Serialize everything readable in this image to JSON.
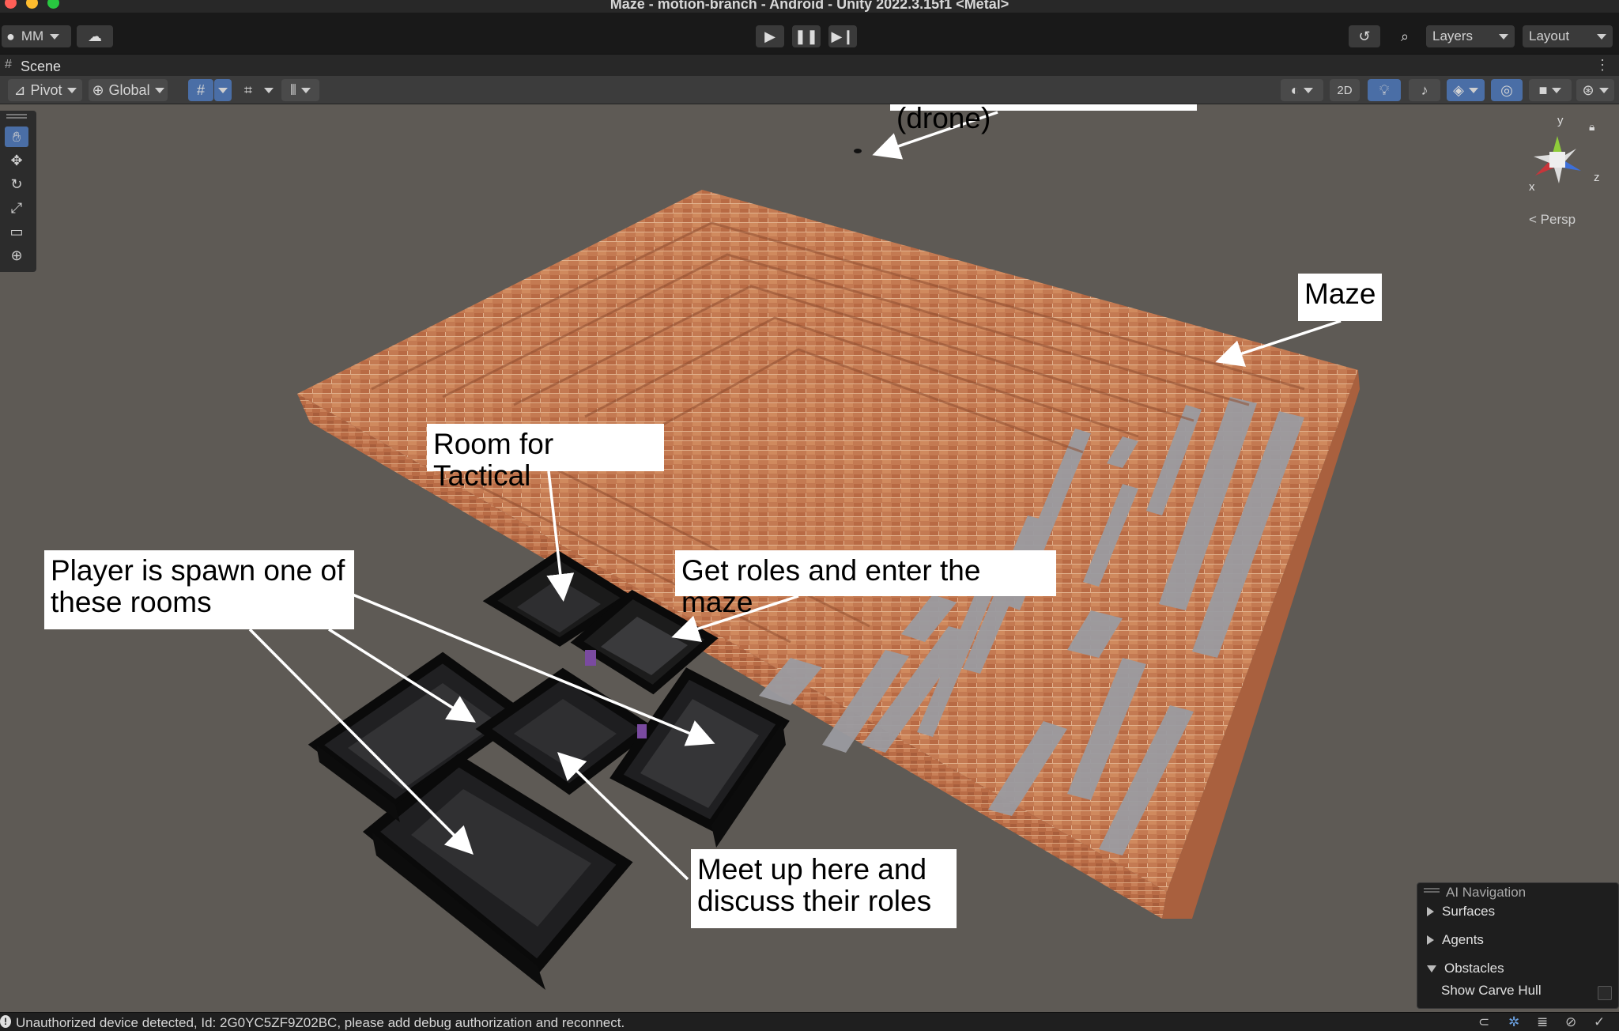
{
  "window": {
    "title": "Maze - motion-branch - Android - Unity 2022.3.15f1 <Metal>"
  },
  "toolbar": {
    "account_label": "MM",
    "layers_label": "Layers",
    "layout_label": "Layout"
  },
  "scene_tab": {
    "label": "Scene"
  },
  "scene_toolbar": {
    "pivot_label": "Pivot",
    "global_label": "Global",
    "twod_label": "2D"
  },
  "gizmo": {
    "y": "y",
    "x": "x",
    "z": "z",
    "persp_label": "Persp"
  },
  "annotations": {
    "drone": "Tactical camera (drone)",
    "maze": "Maze",
    "tactical_room": "Room for Tactical",
    "spawn": "Player is spawn one of these rooms",
    "roles": "Get roles and enter the maze",
    "meetup": "Meet up here and discuss their roles"
  },
  "ai_navigation": {
    "title": "AI Navigation",
    "surfaces": "Surfaces",
    "agents": "Agents",
    "obstacles": "Obstacles",
    "show_carve_hull": "Show Carve Hull"
  },
  "status": {
    "message": "Unauthorized device detected, Id: 2G0YC5ZF9Z02BC, please add debug authorization and reconnect."
  },
  "colors": {
    "brick": "#c97a4e",
    "brick_dark": "#a05a38",
    "floor": "#9a9a9e",
    "room_wall": "#111111",
    "accent": "#4a6ea6"
  }
}
